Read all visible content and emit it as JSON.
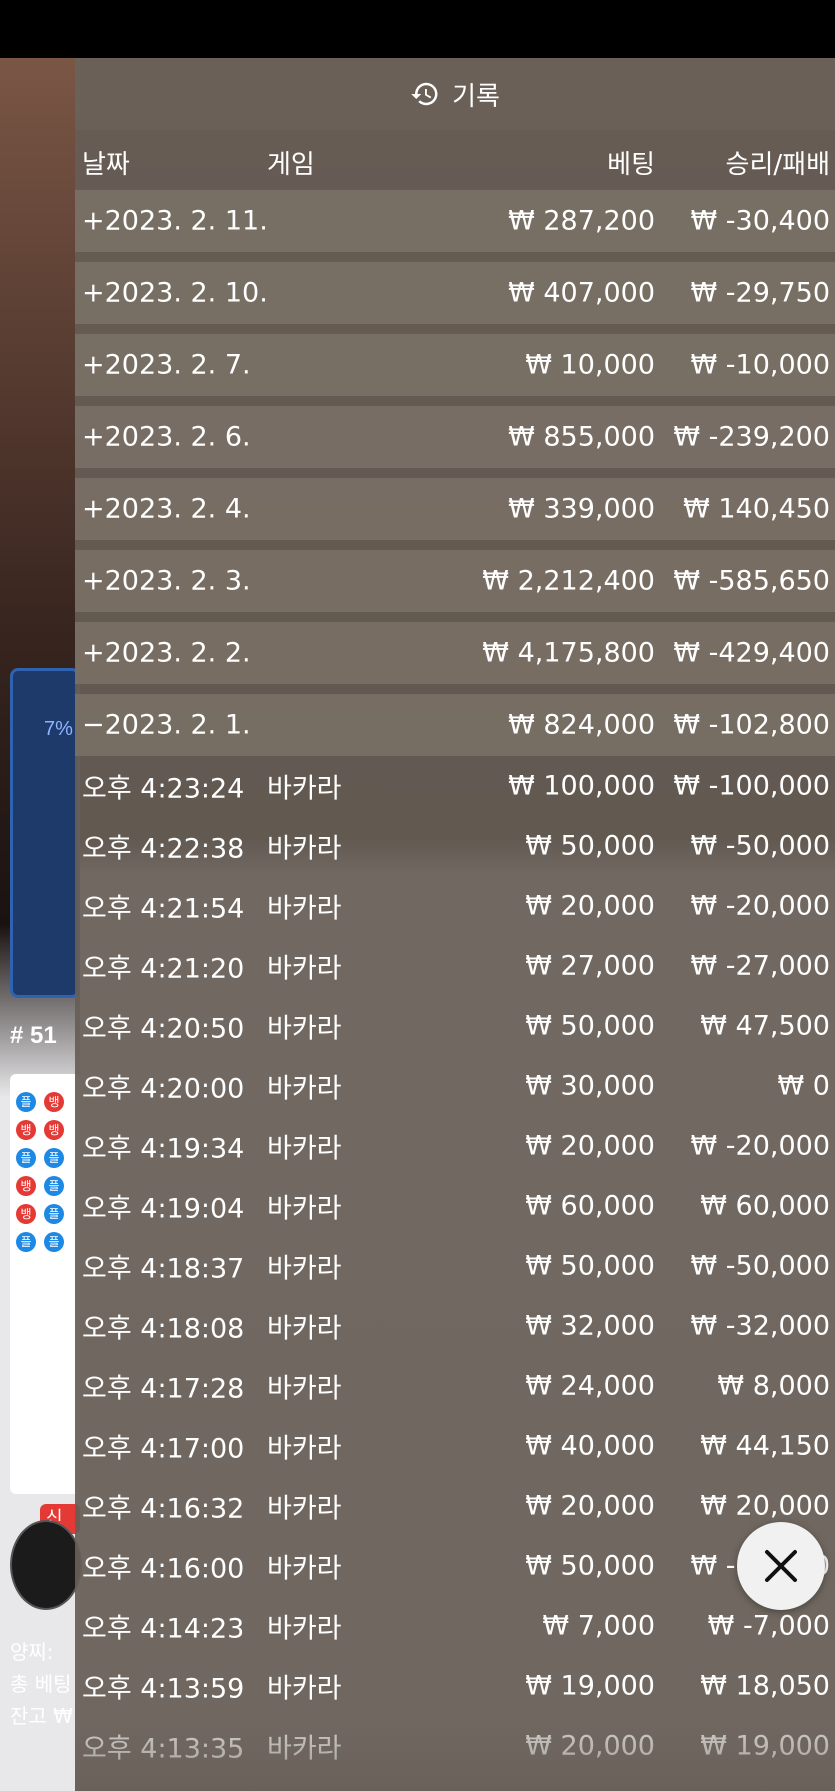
{
  "panel": {
    "title": "기록",
    "icon": "history-icon"
  },
  "columns": {
    "date": "날짜",
    "game": "게임",
    "bet": "베팅",
    "win": "승리/패배"
  },
  "days": [
    {
      "date": "+2023. 2. 11.",
      "bet": "₩ 287,200",
      "win": "₩ -30,400"
    },
    {
      "date": "+2023. 2. 10.",
      "bet": "₩ 407,000",
      "win": "₩ -29,750"
    },
    {
      "date": "+2023. 2. 7.",
      "bet": "₩ 10,000",
      "win": "₩ -10,000"
    },
    {
      "date": "+2023. 2. 6.",
      "bet": "₩ 855,000",
      "win": "₩ -239,200"
    },
    {
      "date": "+2023. 2. 4.",
      "bet": "₩ 339,000",
      "win": "₩ 140,450"
    },
    {
      "date": "+2023. 2. 3.",
      "bet": "₩ 2,212,400",
      "win": "₩ -585,650"
    },
    {
      "date": "+2023. 2. 2.",
      "bet": "₩ 4,175,800",
      "win": "₩ -429,400"
    },
    {
      "date": "−2023. 2. 1.",
      "bet": "₩ 824,000",
      "win": "₩ -102,800"
    }
  ],
  "transactions": [
    {
      "time": "오후 4:23:24",
      "game": "바카라",
      "bet": "₩ 100,000",
      "win": "₩ -100,000"
    },
    {
      "time": "오후 4:22:38",
      "game": "바카라",
      "bet": "₩ 50,000",
      "win": "₩ -50,000"
    },
    {
      "time": "오후 4:21:54",
      "game": "바카라",
      "bet": "₩ 20,000",
      "win": "₩ -20,000"
    },
    {
      "time": "오후 4:21:20",
      "game": "바카라",
      "bet": "₩ 27,000",
      "win": "₩ -27,000"
    },
    {
      "time": "오후 4:20:50",
      "game": "바카라",
      "bet": "₩ 50,000",
      "win": "₩ 47,500"
    },
    {
      "time": "오후 4:20:00",
      "game": "바카라",
      "bet": "₩ 30,000",
      "win": "₩ 0"
    },
    {
      "time": "오후 4:19:34",
      "game": "바카라",
      "bet": "₩ 20,000",
      "win": "₩ -20,000"
    },
    {
      "time": "오후 4:19:04",
      "game": "바카라",
      "bet": "₩ 60,000",
      "win": "₩ 60,000"
    },
    {
      "time": "오후 4:18:37",
      "game": "바카라",
      "bet": "₩ 50,000",
      "win": "₩ -50,000"
    },
    {
      "time": "오후 4:18:08",
      "game": "바카라",
      "bet": "₩ 32,000",
      "win": "₩ -32,000"
    },
    {
      "time": "오후 4:17:28",
      "game": "바카라",
      "bet": "₩ 24,000",
      "win": "₩ 8,000"
    },
    {
      "time": "오후 4:17:00",
      "game": "바카라",
      "bet": "₩ 40,000",
      "win": "₩ 44,150"
    },
    {
      "time": "오후 4:16:32",
      "game": "바카라",
      "bet": "₩ 20,000",
      "win": "₩ 20,000"
    },
    {
      "time": "오후 4:16:00",
      "game": "바카라",
      "bet": "₩ 50,000",
      "win": "₩ -50,000"
    },
    {
      "time": "오후 4:14:23",
      "game": "바카라",
      "bet": "₩ 7,000",
      "win": "₩ -7,000"
    },
    {
      "time": "오후 4:13:59",
      "game": "바카라",
      "bet": "₩ 19,000",
      "win": "₩ 18,050"
    },
    {
      "time": "오후 4:13:35",
      "game": "바카라",
      "bet": "₩ 20,000",
      "win": "₩ 19,000"
    }
  ],
  "background": {
    "percent": "7%",
    "round": "# 51",
    "badge": "신",
    "line1": "양찌: ",
    "line2": "총 베팅",
    "line3": "잔고 ₩"
  },
  "close": {
    "icon": "close-icon"
  }
}
